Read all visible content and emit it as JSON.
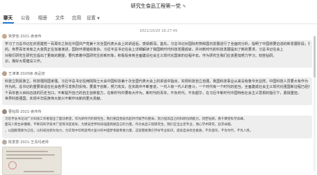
{
  "window": {
    "title": "研究生食品工程第一党"
  },
  "tabs": [
    {
      "label": "聊天"
    },
    {
      "label": "公告"
    },
    {
      "label": "相册"
    },
    {
      "label": "文件"
    },
    {
      "label": "应用"
    },
    {
      "label": "设置"
    }
  ],
  "chat": {
    "date": "2021/10/20 16:27:45",
    "messages": [
      {
        "sender": "常梦佳·2021-食食传",
        "avatar_color": "#c8a98d",
        "lines": [
          "学习了习总书记在庆祝建党一百周年之际在中国共产党第十次全国代表大会上的讲话后，感受颇深。首先，习总书记对国际形势和国内发展进行了全面的分析，指明了中国将要迈进的新发展阶段，我国广大科技工作者要大有作为。",
          "的。世界百年未有之大变局正在加速演进，国际环境错综复杂，习近平总书记在会上详细解读了我国新时代科技发展成就，并对新时代的科技发展提出了新的要求，习总书记在会上",
          "对我们研究生研究生提出了更高的期望，要代表着中国研究生的新形象，积极投身到全面建设社会主义现代化国家的征程中去。作为研究生我们应该更加努力学习，刻苦钻研。",
          "识，做好大局建设工作。"
        ]
      },
      {
        "sender": "王津津·2020级-食品安",
        "avatar_color": "#b7a08e",
        "lines": [
          "科技立则民族立，科技强则国家强。习近平总书记在两院院士大会中国科协第十次全国代表大会上的讲话中指出，实现科技自立自强，我国科技事业从来没有像今天这样，中国科技人员要大有作为",
          "作为的。总书记的重要讲话在社会各界引发热烈反响，要勇于创新，努力攻关，在实践中不断奋进，一代人有一代人的奋斗，一个时代有一个时代的担当，全面建成社会主义现代化强国新征程已经开启，",
          "个百年奋斗目标迈进的历史当口，不断提升自己的自主创新能力，在新时代中要有大作为。新时代的青年，不负时代，不负韶华，在习近平新时代中国特色社会主义思想的指引下，勇挑重担，",
          "世界科技强国、实现中华民族伟大复兴不断作出新的更大贡献。"
        ]
      },
      {
        "sender": "曹钰阳·2021-食传传",
        "avatar_color": "#9a8a80",
        "lines": [
          "习近平总书记对广大科技工作者提出了殷切希望，作为新时代的研究生，我们要自觉肩负起时代赋予的使命，努力提高自己的科研创新能力，刻苦钻研，勇于攀登科学高峰，",
          "面向人民生命健康，不断向科学技术广度和深度进军，为建设世界科技强国贡献自己的力量。作为食品工程研究生，我们应当立足专业，潜心学术研究，追求卓越，",
          "，以国家需要为己任，以科技创新为动力，为实现中华民族伟大复兴的中国梦贡献青春力量，这就需要我们学好专业知识，提高自身综合素质，不负韶华，不负时代，不负人民。"
        ]
      },
      {
        "sender": "陈爱爱·2021-王青玛老师",
        "avatar_color": "#b9aaa0"
      }
    ]
  }
}
